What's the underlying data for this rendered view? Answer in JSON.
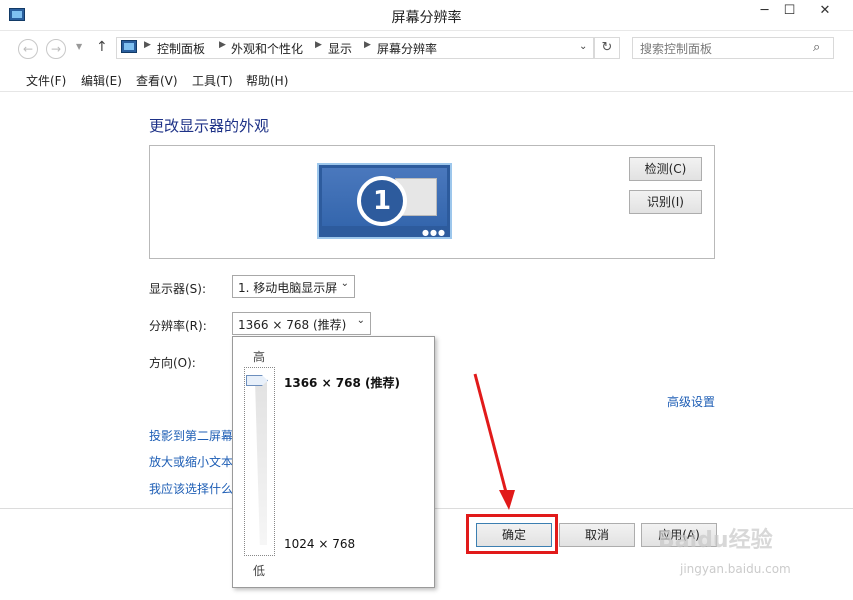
{
  "window": {
    "title": "屏幕分辨率"
  },
  "address": {
    "breadcrumbs": [
      "控制面板",
      "外观和个性化",
      "显示",
      "屏幕分辨率"
    ],
    "search_placeholder": "搜索控制面板"
  },
  "menu": {
    "items": [
      "文件(F)",
      "编辑(E)",
      "查看(V)",
      "工具(T)",
      "帮助(H)"
    ]
  },
  "page": {
    "heading": "更改显示器的外观",
    "monitor_number": "1",
    "detect_label": "检测(C)",
    "identify_label": "识别(I)",
    "display_label": "显示器(S):",
    "display_value": "1. 移动电脑显示屏",
    "resolution_label": "分辨率(R):",
    "resolution_value": "1366 × 768 (推荐)",
    "orientation_label": "方向(O):",
    "advanced_link": "高级设置",
    "links": [
      "投影到第二屏幕",
      "放大或缩小文本",
      "我应该选择什么"
    ]
  },
  "resolution_popup": {
    "high_label": "高",
    "low_label": "低",
    "max_option": "1366 × 768 (推荐)",
    "min_option": "1024 × 768"
  },
  "buttons": {
    "ok": "确定",
    "cancel": "取消",
    "apply": "应用(A)"
  },
  "watermark": {
    "logo": "Baidu经验",
    "url": "jingyan.baidu.com"
  },
  "colors": {
    "link": "#1e5eb5",
    "heading": "#1e3287",
    "highlight": "#e11a1a"
  }
}
